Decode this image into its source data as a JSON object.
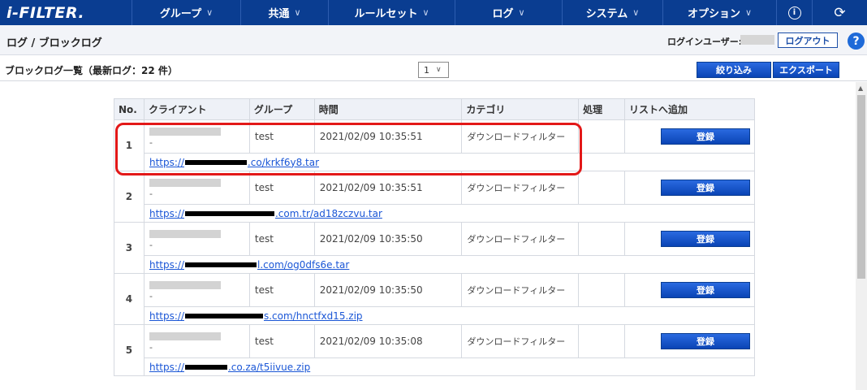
{
  "app": {
    "logo": "i-FILTER."
  },
  "nav": {
    "items": [
      {
        "label": "グループ"
      },
      {
        "label": "共通"
      },
      {
        "label": "ルールセット"
      },
      {
        "label": "ログ"
      },
      {
        "label": "システム"
      },
      {
        "label": "オプション"
      }
    ],
    "info_icon": "i",
    "refresh_icon": "⟳"
  },
  "header": {
    "breadcrumb": "ログ / ブロックログ",
    "login_label": "ログインユーザー:",
    "logout": "ログアウト",
    "help": "?"
  },
  "toolbar": {
    "list_title": "ブロックログ一覧（最新ログ：22 件）",
    "page_value": "1",
    "filter_button": "絞り込み",
    "export_button": "エクスポート"
  },
  "table": {
    "columns": [
      "No.",
      "クライアント",
      "グループ",
      "時間",
      "カテゴリ",
      "処理",
      "リストへ追加"
    ],
    "rows": [
      {
        "no": "1",
        "client_dash": "-",
        "group": "test",
        "time": "2021/02/09 10:35:51",
        "category": "ダウンロードフィルター",
        "action": "",
        "register": "登録",
        "url_prefix": "https://",
        "url_suffix": ".co/krkf6y8.tar"
      },
      {
        "no": "2",
        "client_dash": "-",
        "group": "test",
        "time": "2021/02/09 10:35:51",
        "category": "ダウンロードフィルター",
        "action": "",
        "register": "登録",
        "url_prefix": "https://",
        "url_suffix": ".com.tr/ad18zczvu.tar"
      },
      {
        "no": "3",
        "client_dash": "-",
        "group": "test",
        "time": "2021/02/09 10:35:50",
        "category": "ダウンロードフィルター",
        "action": "",
        "register": "登録",
        "url_prefix": "https://",
        "url_suffix": "l.com/og0dfs6e.tar"
      },
      {
        "no": "4",
        "client_dash": "-",
        "group": "test",
        "time": "2021/02/09 10:35:50",
        "category": "ダウンロードフィルター",
        "action": "",
        "register": "登録",
        "url_prefix": "https://",
        "url_suffix": "s.com/hnctfxd15.zip"
      },
      {
        "no": "5",
        "client_dash": "-",
        "group": "test",
        "time": "2021/02/09 10:35:08",
        "category": "ダウンロードフィルター",
        "action": "",
        "register": "登録",
        "url_prefix": "https://",
        "url_suffix": ".co.za/t5iivue.zip"
      }
    ]
  },
  "colors": {
    "nav_bg": "#0a3d91",
    "button_blue": "#0a44b5",
    "link": "#1a56d6",
    "highlight": "#e31818"
  }
}
